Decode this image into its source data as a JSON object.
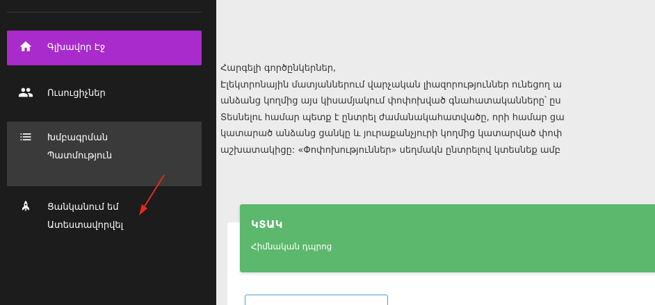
{
  "sidebar": {
    "items": [
      {
        "label_lines": [
          "Գլխավոր Էջ"
        ],
        "icon": "home-icon",
        "active": true
      },
      {
        "label_lines": [
          "Ուսուցիչներ"
        ],
        "icon": "users-icon"
      },
      {
        "label_lines": [
          "Խմբագրման",
          "Պատմություն"
        ],
        "icon": "list-icon",
        "highlighted": true
      },
      {
        "label_lines": [
          "Ցանկանում եմ",
          "Ատեստավորվել"
        ],
        "icon": "rocket-icon"
      }
    ]
  },
  "main": {
    "intro_lines": [
      "Հարգելի գործընկերներ,",
      "Էլեկտրոնային մատյաններում վարչական լիազորություններ ունեցող ա",
      "անձանց կողմից այս կիսամյակում փոփոխված գնահատականները՝ ըս",
      "Տեսնելու համար պետք է ընտրել ժամանակահատվածը, որի համար ցա",
      "կատարած անձանց ցանկը և յուրաքանչյուրի կողմից կատարված փոփ",
      "աշխատակիցը: «Փոփոխություններ» սեղմակն ընտրելով կտեսնեք ամբ"
    ],
    "card": {
      "title": "ԿՏԱԿ",
      "subtitle": "Հիմնական դպրոց"
    }
  },
  "colors": {
    "sidebar_bg": "#1c1c1c",
    "active_item": "#a92bcb",
    "highlight_item": "#3a3a3a",
    "card_green": "#5cb86c",
    "annotation_arrow": "#e8281e"
  }
}
